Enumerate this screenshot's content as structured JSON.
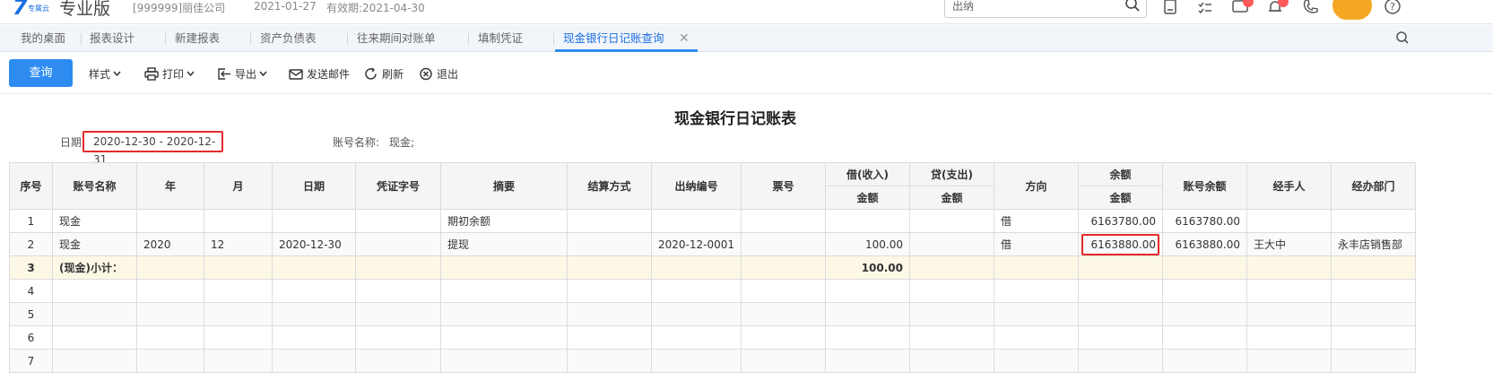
{
  "header": {
    "logo_mark": "7",
    "logo_sub": "专属云",
    "logo_text": "专业版",
    "company": "[999999]丽佳公司",
    "current_date": "2021-01-27",
    "expiry": "有效期:2021-04-30",
    "search_value": "出纳"
  },
  "tabs": [
    {
      "label": "我的桌面"
    },
    {
      "label": "报表设计"
    },
    {
      "label": "新建报表"
    },
    {
      "label": "资产负债表"
    },
    {
      "label": "往来期间对账单"
    },
    {
      "label": "填制凭证"
    },
    {
      "label": "现金银行日记账查询"
    }
  ],
  "toolbar": {
    "query": "查询",
    "style": "样式",
    "print": "打印",
    "export": "导出",
    "send_mail": "发送邮件",
    "refresh": "刷新",
    "exit": "退出"
  },
  "report": {
    "title": "现金银行日记账表",
    "date_label": "日期:",
    "date_range": "2020-12-30 - 2020-12-31",
    "account_label": "账号名称:",
    "account_value": "现金;"
  },
  "table": {
    "headers": {
      "seq": "序号",
      "account": "账号名称",
      "year": "年",
      "month": "月",
      "date": "日期",
      "voucher": "凭证字号",
      "summary": "摘要",
      "settle": "结算方式",
      "cashier_no": "出纳编号",
      "ticket": "票号",
      "debit": "借(收入)",
      "credit": "贷(支出)",
      "amount": "金额",
      "direction": "方向",
      "balance": "余额",
      "account_balance": "账号余额",
      "handler": "经手人",
      "dept": "经办部门"
    },
    "rows": [
      {
        "seq": "1",
        "account": "现金",
        "year": "",
        "month": "",
        "date": "",
        "voucher": "",
        "summary": "期初余额",
        "settle": "",
        "cashier_no": "",
        "ticket": "",
        "debit": "",
        "credit": "",
        "direction": "借",
        "balance": "6163780.00",
        "account_balance": "6163780.00",
        "handler": "",
        "dept": ""
      },
      {
        "seq": "2",
        "account": "现金",
        "year": "2020",
        "month": "12",
        "date": "2020-12-30",
        "voucher": "",
        "summary": "提现",
        "settle": "",
        "cashier_no": "2020-12-0001",
        "ticket": "",
        "debit": "100.00",
        "credit": "",
        "direction": "借",
        "balance": "6163880.00",
        "account_balance": "6163880.00",
        "handler": "王大中",
        "dept": "永丰店销售部"
      },
      {
        "seq": "3",
        "account": "(现金)小计：",
        "debit": "100.00"
      },
      {
        "seq": "4"
      },
      {
        "seq": "5"
      },
      {
        "seq": "6"
      },
      {
        "seq": "7"
      }
    ]
  },
  "colors": {
    "accent": "#2e8cf0",
    "highlight_border": "#e52b2b",
    "subtotal_bg": "#fdf8e6"
  }
}
